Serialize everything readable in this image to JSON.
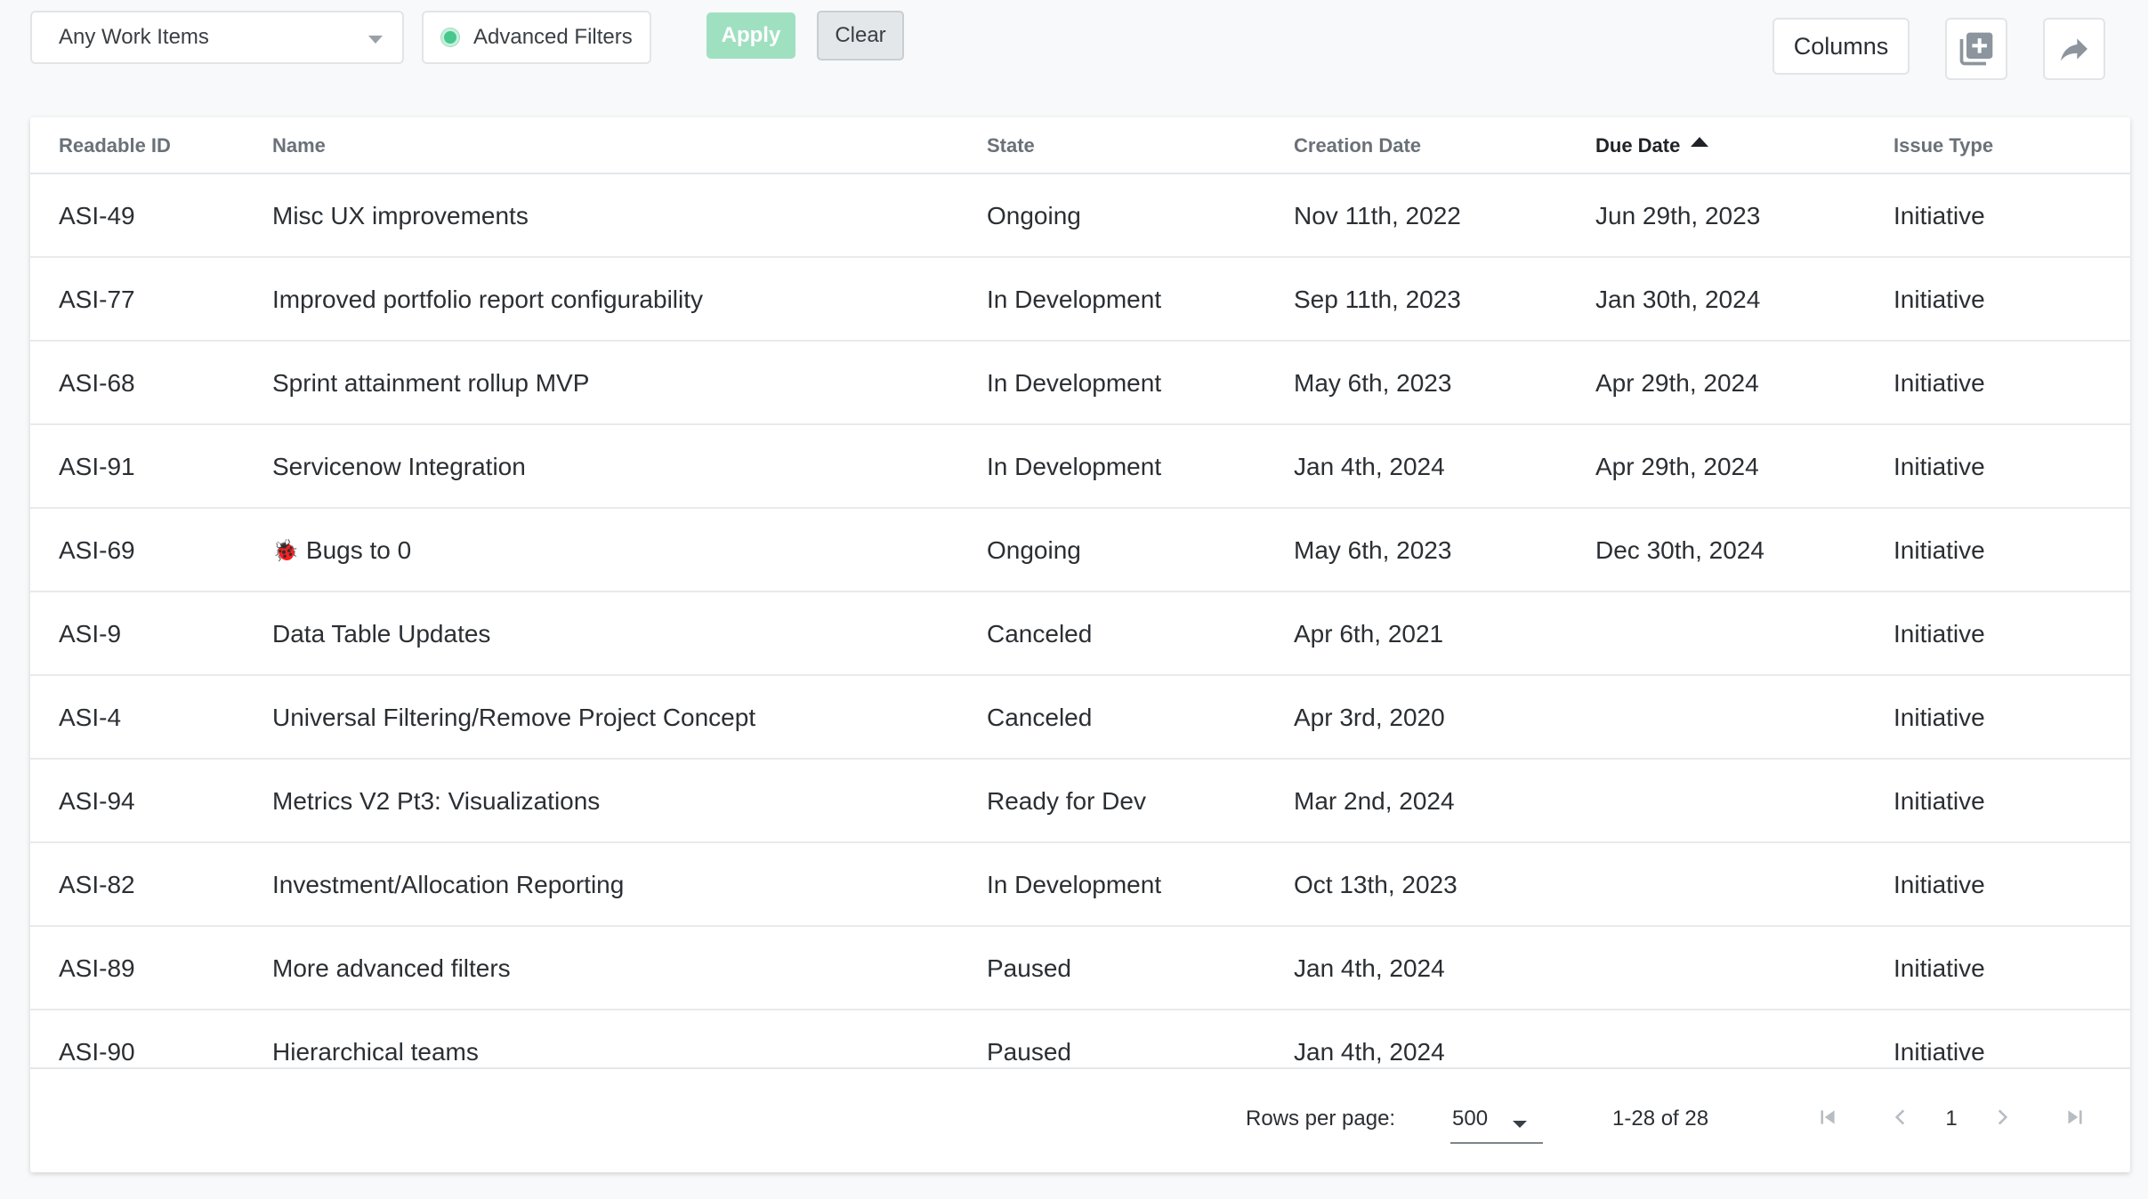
{
  "toolbar": {
    "work_items_select": "Any Work Items",
    "advanced_filters_label": "Advanced Filters",
    "apply_label": "Apply",
    "clear_label": "Clear",
    "columns_label": "Columns",
    "add_icon": "add-box-icon",
    "share_icon": "share-arrow-icon"
  },
  "table": {
    "headers": {
      "readable_id": "Readable ID",
      "name": "Name",
      "state": "State",
      "creation_date": "Creation Date",
      "due_date": "Due Date",
      "issue_type": "Issue Type"
    },
    "sorted_by": "Due Date",
    "sort_direction": "ascending",
    "rows": [
      {
        "id": "ASI-49",
        "name": "Misc UX improvements",
        "state": "Ongoing",
        "created": "Nov 11th, 2022",
        "due": "Jun 29th, 2023",
        "type": "Initiative"
      },
      {
        "id": "ASI-77",
        "name": "Improved portfolio report configurability",
        "state": "In Development",
        "created": "Sep 11th, 2023",
        "due": "Jan 30th, 2024",
        "type": "Initiative"
      },
      {
        "id": "ASI-68",
        "name": "Sprint attainment rollup MVP",
        "state": "In Development",
        "created": "May 6th, 2023",
        "due": "Apr 29th, 2024",
        "type": "Initiative"
      },
      {
        "id": "ASI-91",
        "name": "Servicenow Integration",
        "state": "In Development",
        "created": "Jan 4th, 2024",
        "due": "Apr 29th, 2024",
        "type": "Initiative"
      },
      {
        "id": "ASI-69",
        "name_emoji": "🐞",
        "name": "Bugs to 0",
        "state": "Ongoing",
        "created": "May 6th, 2023",
        "due": "Dec 30th, 2024",
        "type": "Initiative"
      },
      {
        "id": "ASI-9",
        "name": "Data Table Updates",
        "state": "Canceled",
        "created": "Apr 6th, 2021",
        "due": "",
        "type": "Initiative"
      },
      {
        "id": "ASI-4",
        "name": "Universal Filtering/Remove Project Concept",
        "state": "Canceled",
        "created": "Apr 3rd, 2020",
        "due": "",
        "type": "Initiative"
      },
      {
        "id": "ASI-94",
        "name": "Metrics V2 Pt3: Visualizations",
        "state": "Ready for Dev",
        "created": "Mar 2nd, 2024",
        "due": "",
        "type": "Initiative"
      },
      {
        "id": "ASI-82",
        "name": "Investment/Allocation Reporting",
        "state": "In Development",
        "created": "Oct 13th, 2023",
        "due": "",
        "type": "Initiative"
      },
      {
        "id": "ASI-89",
        "name": "More advanced filters",
        "state": "Paused",
        "created": "Jan 4th, 2024",
        "due": "",
        "type": "Initiative"
      },
      {
        "id": "ASI-90",
        "name": "Hierarchical teams",
        "state": "Paused",
        "created": "Jan 4th, 2024",
        "due": "",
        "type": "Initiative"
      }
    ]
  },
  "pagination": {
    "rows_per_page_label": "Rows per page:",
    "rows_per_page_value": "500",
    "range_text": "1-28 of 28",
    "current_page": "1"
  },
  "colors": {
    "accent_green": "#48c78e",
    "apply_disabled": "#9fe0c1",
    "background": "#f8f9fa"
  }
}
